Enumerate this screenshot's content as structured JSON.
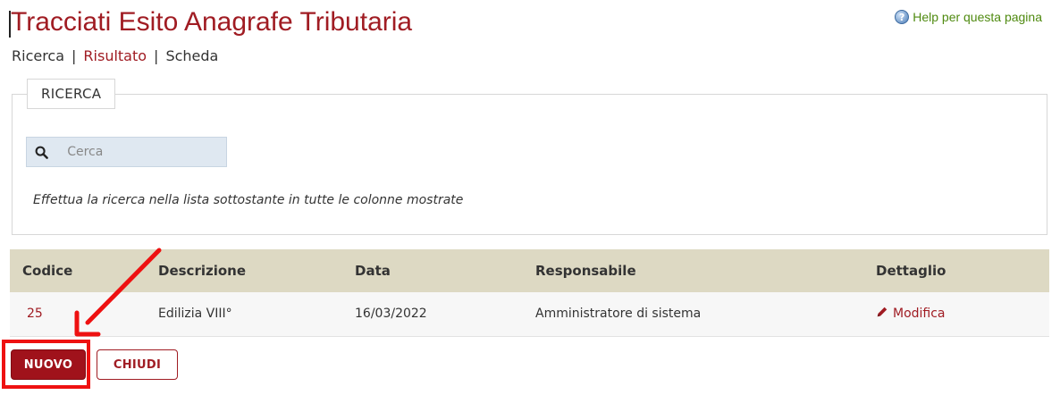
{
  "page": {
    "title": "Tracciati Esito Anagrafe Tributaria",
    "help_label": "Help per questa pagina"
  },
  "breadcrumb": [
    {
      "label": "Ricerca",
      "active": false
    },
    {
      "label": "Risultato",
      "active": true
    },
    {
      "label": "Scheda",
      "active": false
    }
  ],
  "search": {
    "legend": "RICERCA",
    "placeholder": "Cerca",
    "value": "",
    "hint": "Effettua la ricerca nella lista sottostante in tutte le colonne mostrate"
  },
  "table": {
    "columns": [
      "Codice",
      "Descrizione",
      "Data",
      "Responsabile",
      "Dettaglio"
    ],
    "rows": [
      {
        "codice": "25",
        "descrizione": "Edilizia VIII°",
        "data": "16/03/2022",
        "responsabile": "Amministratore di sistema",
        "dettaglio": "Modifica"
      }
    ]
  },
  "actions": {
    "new_label": "NUOVO",
    "close_label": "CHIUDI"
  },
  "icons": {
    "help": "help-icon",
    "search": "search-icon",
    "edit": "pencil-icon"
  },
  "colors": {
    "brand": "#a01c23",
    "help_link": "#4f8a10",
    "table_header_bg": "#ddd9c3",
    "annotation": "#ee1111"
  }
}
